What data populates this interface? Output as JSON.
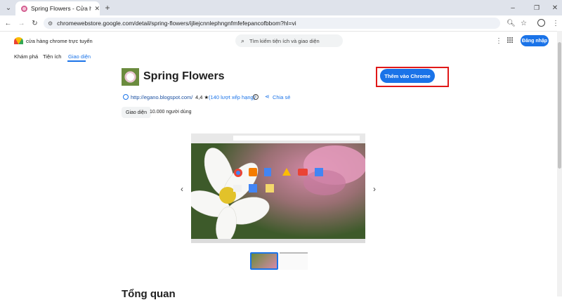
{
  "browser": {
    "tab_title": "Spring Flowers - Cửa hàng Chro",
    "url": "chromewebstore.google.com/detail/spring-flowers/ijliejcnnlephngnfmfefepancofbbom?hl=vi"
  },
  "store": {
    "brand": "cửa hàng chrome trực tuyến",
    "nav": [
      "Khám phá",
      "Tiện ích",
      "Giao diện"
    ],
    "search_placeholder": "Tìm kiếm tiện ích và giao diện",
    "login_label": "Đăng nhập"
  },
  "item": {
    "title": "Spring Flowers",
    "website": "http://egano.blogspot.com/",
    "rating": "4,4 ★",
    "rating_count": "(140 lượt xếp hạng)",
    "share_label": "Chia sẻ",
    "category": "Giao diện",
    "users": "10.000 người dùng",
    "add_button": "Thêm vào Chrome"
  },
  "overview_heading": "Tổng quan",
  "colors": {
    "accent": "#1a73e8",
    "highlight": "#e01818"
  }
}
